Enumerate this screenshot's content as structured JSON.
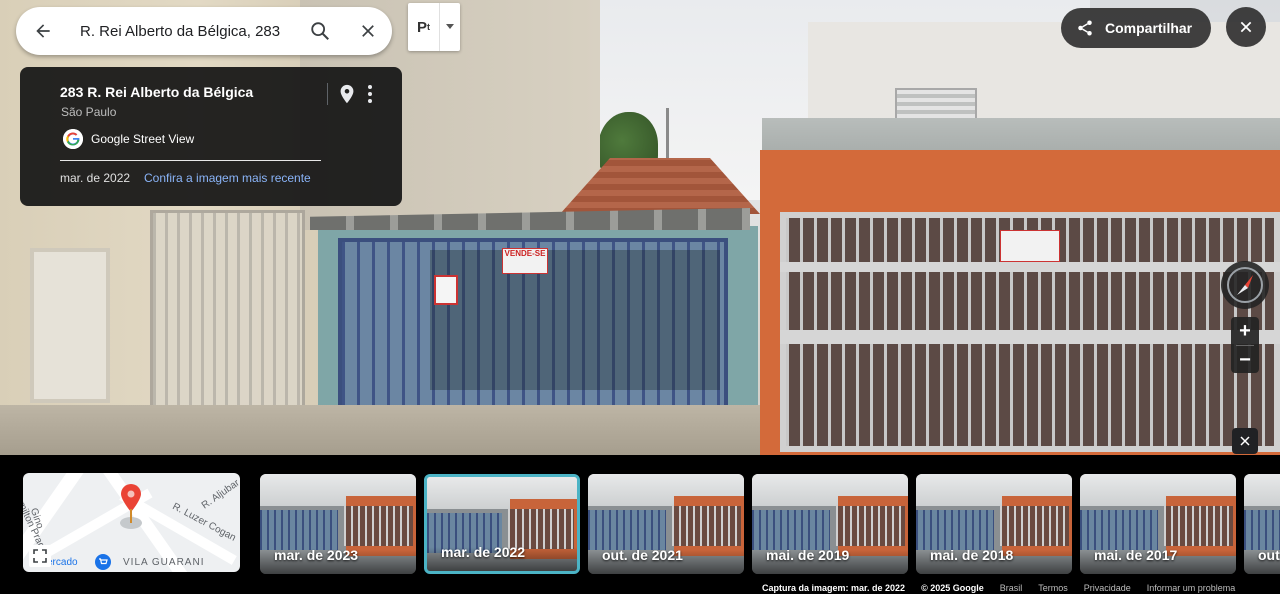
{
  "search": {
    "query": "R. Rei Alberto da Bélgica, 283",
    "back_icon": "arrow-left-icon",
    "search_icon": "search-icon",
    "clear_icon": "close-icon"
  },
  "pegman": {
    "label": "P",
    "icon": "pegman-icon",
    "dropdown_icon": "caret-down-icon"
  },
  "info_card": {
    "title": "283 R. Rei Alberto da Bélgica",
    "subtitle": "São Paulo",
    "source": "Google Street View",
    "date": "mar. de 2022",
    "recent_link": "Confira a imagem mais recente"
  },
  "top_right": {
    "share_label": "Compartilhar"
  },
  "scene": {
    "sign_text": "VENDE-SE"
  },
  "zoom": {
    "in_label": "+",
    "out_label": "−"
  },
  "minimap": {
    "labels": [
      "amilton Prado",
      "R. Aljubar",
      "R. Luzer Cogan",
      "Gino",
      "VILA GUARANI",
      "ercado"
    ]
  },
  "timeline": [
    {
      "label": "mar. de 2023",
      "selected": false
    },
    {
      "label": "mar. de 2022",
      "selected": true
    },
    {
      "label": "out. de 2021",
      "selected": false
    },
    {
      "label": "mai. de 2019",
      "selected": false
    },
    {
      "label": "mai. de 2018",
      "selected": false
    },
    {
      "label": "mai. de 2017",
      "selected": false
    },
    {
      "label": "out",
      "selected": false
    }
  ],
  "footer": {
    "capture": "Captura da imagem: mar. de 2022",
    "copyright": "© 2025 Google",
    "country": "Brasil",
    "terms": "Termos",
    "privacy": "Privacidade",
    "report": "Informar um problema"
  },
  "colors": {
    "accent_link": "#8ab4f8",
    "selected_border": "#4bb3c5",
    "pin_red": "#ea4335"
  }
}
